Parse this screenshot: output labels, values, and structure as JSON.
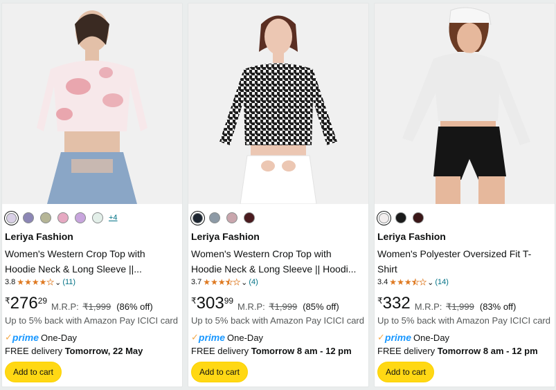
{
  "products": [
    {
      "swatches": [
        "#d9d0e6",
        "#8c86b5",
        "#b5b596",
        "#e6a9c2",
        "#c8a5dd",
        "#e3efe9"
      ],
      "more_colors": "+4",
      "brand": "Leriya Fashion",
      "title": "Women's Western Crop Top with Hoodie Neck & Long Sleeve ||...",
      "rating": "3.8",
      "stars": 3.8,
      "review_count": "(11)",
      "currency": "₹",
      "price_whole": "276",
      "price_fraction": "29",
      "mrp_label": "M.R.P:",
      "mrp_value": "₹1,999",
      "discount": "(86% off)",
      "cashback": "Up to 5% back with Amazon Pay ICICI card",
      "prime_word": "prime",
      "prime_speed": "One-Day",
      "delivery_prefix": "FREE delivery",
      "delivery_date": "Tomorrow, 22 May",
      "button_label": "Add to cart"
    },
    {
      "swatches": [
        "#1d2530",
        "#8d9aa6",
        "#c9a6ad",
        "#4a1b1f"
      ],
      "more_colors": "",
      "brand": "Leriya Fashion",
      "title": "Women's Western Crop Top with Hoodie Neck & Long Sleeve || Hoodi...",
      "rating": "3.7",
      "stars": 3.7,
      "review_count": "(4)",
      "currency": "₹",
      "price_whole": "303",
      "price_fraction": "99",
      "mrp_label": "M.R.P:",
      "mrp_value": "₹1,999",
      "discount": "(85% off)",
      "cashback": "Up to 5% back with Amazon Pay ICICI card",
      "prime_word": "prime",
      "prime_speed": "One-Day",
      "delivery_prefix": "FREE delivery",
      "delivery_date": "Tomorrow 8 am - 12 pm",
      "button_label": "Add to cart"
    },
    {
      "swatches": [
        "#f2eeee",
        "#1b1b1b",
        "#3a1718"
      ],
      "more_colors": "",
      "brand": "Leriya Fashion",
      "title": "Women's Polyester Oversized Fit T-Shirt",
      "rating": "3.4",
      "stars": 3.4,
      "review_count": "(14)",
      "currency": "₹",
      "price_whole": "332",
      "price_fraction": "",
      "mrp_label": "M.R.P:",
      "mrp_value": "₹1,999",
      "discount": "(83% off)",
      "cashback": "Up to 5% back with Amazon Pay ICICI card",
      "prime_word": "prime",
      "prime_speed": "One-Day",
      "delivery_prefix": "FREE delivery",
      "delivery_date": "Tomorrow 8 am - 12 pm",
      "button_label": "Add to cart"
    }
  ],
  "icons": {
    "star": "star-icon",
    "chevron": "chevron-down-icon",
    "prime": "prime-check-icon"
  },
  "colors": {
    "star": "#de7921",
    "link": "#007185",
    "prime": "#1a98ff",
    "button": "#ffd814"
  }
}
